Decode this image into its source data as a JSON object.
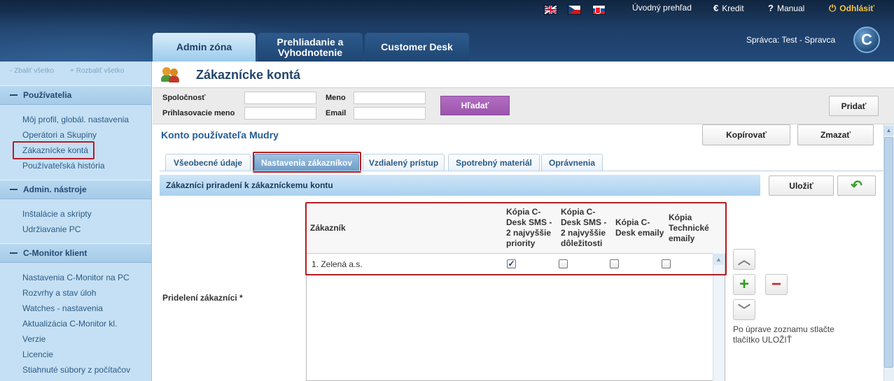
{
  "header": {
    "languages": [
      "EN",
      "CZ",
      "SK"
    ],
    "links": {
      "overview": "Úvodný prehľad",
      "credit": "Kredit",
      "credit_icon": "€",
      "manual": "Manual",
      "manual_icon": "?",
      "logout": "Odhlásiť",
      "logout_icon": "⏻"
    },
    "tabs": [
      "Admin zóna",
      "Prehliadanie a Vyhodnotenie",
      "Customer Desk"
    ],
    "tab_review_line1": "Prehliadanie a",
    "tab_review_line2": "Vyhodnotenie",
    "admin_prefix": "Správca:",
    "admin_name": "Test - Spravca",
    "logo_letter": "C"
  },
  "sidebar": {
    "collapse_all": "- Zbaliť všetko",
    "expand_all": "+ Rozbaliť všetko",
    "sections": [
      {
        "title": "Používatelia",
        "items": [
          "Môj profil, globál. nastavenia",
          "Operátori a Skupiny",
          "Zákaznícke kontá",
          "Používateľská história"
        ]
      },
      {
        "title": "Admin. nástroje",
        "items": [
          "Inštalácie a skripty",
          "Udržiavanie PC"
        ]
      },
      {
        "title": "C-Monitor klient",
        "items": [
          "Nastavenia C-Monitor na PC",
          "Rozvrhy a stav úloh",
          "Watches - nastavenia",
          "Aktualizácia C-Monitor kl.",
          "Verzie",
          "Licencie",
          "Stiahnuté súbory z počítačov"
        ]
      }
    ]
  },
  "page": {
    "title": "Zákaznícke kontá",
    "filters": {
      "company_label": "Spoločnosť",
      "login_label": "Prihlasovacie meno",
      "name_label": "Meno",
      "email_label": "Email",
      "company_value": "",
      "login_value": "",
      "name_value": "",
      "email_value": ""
    },
    "search_button": "Hľadať",
    "add_button": "Pridať",
    "account_title": "Konto používateľa Mudry",
    "copy_button": "Kopírovať",
    "delete_button": "Zmazať",
    "subtabs": [
      "Všeobecné údaje",
      "Nastavenia zákazníkov",
      "Vzdialený prístup",
      "Spotrebný materiál",
      "Oprávnenia"
    ],
    "active_subtab": "Nastavenia zákazníkov",
    "section_title": "Zákazníci priradení k zákazníckemu kontu",
    "save_button": "Uložiť",
    "back_icon": "↶",
    "assign_label": "Pridelení zákazníci *",
    "table": {
      "headers": {
        "customer": "Zákazník",
        "sms_high": "Kópia C-Desk SMS - 2 najvyššie priority",
        "sms_importance": "Kópia C-Desk SMS - 2 najvyššie dôležitosti",
        "email": "Kópia C-Desk emaily",
        "tech_email": "Kópia Technické emaily"
      },
      "rows": [
        {
          "customer": "1. Zelená a.s.",
          "sms_high": true,
          "sms_importance": false,
          "email": false,
          "tech_email": false
        }
      ]
    },
    "controls": {
      "up": "︿",
      "plus": "+",
      "minus": "−",
      "down": "﹀"
    },
    "hint": "Po úprave zoznamu stlačte tlačítko ULOŽIŤ"
  }
}
